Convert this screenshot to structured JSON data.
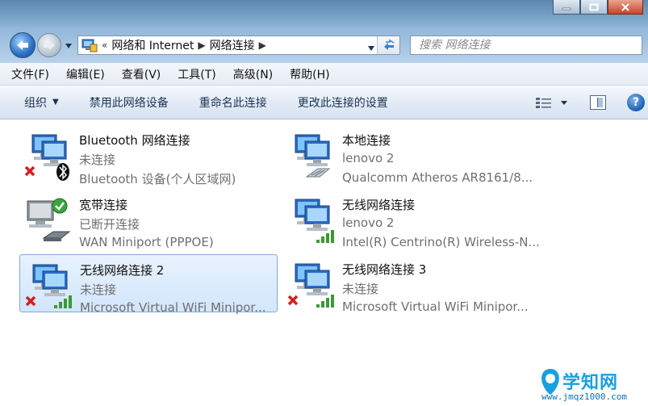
{
  "window": {
    "caption_buttons": [
      "minimize",
      "maximize",
      "close"
    ]
  },
  "address": {
    "overflow": "«",
    "crumbs": [
      "网络和 Internet",
      "网络连接"
    ],
    "search_placeholder": "搜索 网络连接"
  },
  "menu": {
    "items": [
      "文件(F)",
      "编辑(E)",
      "查看(V)",
      "工具(T)",
      "高级(N)",
      "帮助(H)"
    ]
  },
  "commands": {
    "organize": "组织",
    "disable": "禁用此网络设备",
    "rename": "重命名此连接",
    "change_settings": "更改此连接的设置"
  },
  "connections": [
    {
      "name": "Bluetooth 网络连接",
      "status": "未连接",
      "device": "Bluetooth 设备(个人区域网)",
      "icon": "bluetooth-network-icon",
      "state": "disconnected",
      "selected": false
    },
    {
      "name": "本地连接",
      "status": "lenovo  2",
      "device": "Qualcomm Atheros AR8161/8...",
      "icon": "ethernet-network-icon",
      "state": "connected",
      "selected": false
    },
    {
      "name": "宽带连接",
      "status": "已断开连接",
      "device": "WAN Miniport (PPPOE)",
      "icon": "broadband-network-icon",
      "state": "dialup",
      "selected": false
    },
    {
      "name": "无线网络连接",
      "status": "lenovo  2",
      "device": "Intel(R) Centrino(R) Wireless-N...",
      "icon": "wireless-network-icon",
      "state": "connected",
      "selected": false
    },
    {
      "name": "无线网络连接 2",
      "status": "未连接",
      "device": "Microsoft Virtual WiFi Minipor...",
      "icon": "wireless-network-icon",
      "state": "disconnected",
      "selected": true
    },
    {
      "name": "无线网络连接 3",
      "status": "未连接",
      "device": "Microsoft Virtual WiFi Minipor...",
      "icon": "wireless-network-icon",
      "state": "disconnected",
      "selected": false
    }
  ],
  "watermark": {
    "brand": "学知网",
    "url": "www.jmqz1000.com"
  }
}
